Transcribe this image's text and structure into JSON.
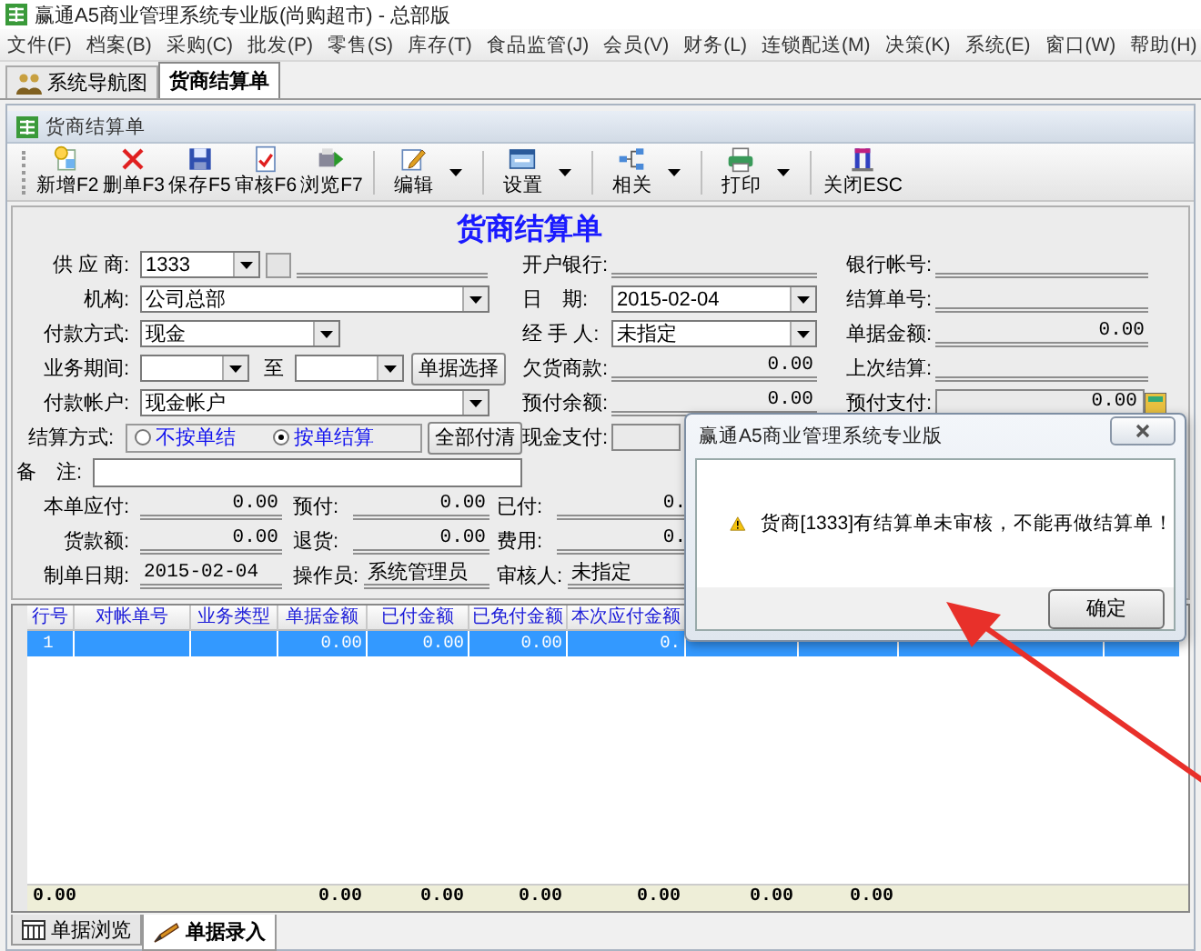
{
  "window": {
    "title": "赢通A5商业管理系统专业版(尚购超市) - 总部版"
  },
  "menu": [
    "文件(F)",
    "档案(B)",
    "采购(C)",
    "批发(P)",
    "零售(S)",
    "库存(T)",
    "食品监管(J)",
    "会员(V)",
    "财务(L)",
    "连锁配送(M)",
    "决策(K)",
    "系统(E)",
    "窗口(W)",
    "帮助(H)"
  ],
  "tabs": [
    {
      "label": "系统导航图",
      "selected": false
    },
    {
      "label": "货商结算单",
      "selected": true
    }
  ],
  "panel": {
    "title": "货商结算单"
  },
  "toolbar": [
    {
      "label": "新增F2",
      "kind": "button"
    },
    {
      "label": "删单F3",
      "kind": "button"
    },
    {
      "label": "保存F5",
      "kind": "button"
    },
    {
      "label": "审核F6",
      "kind": "button"
    },
    {
      "label": "浏览F7",
      "kind": "button"
    },
    {
      "label": "编辑",
      "kind": "dropdown"
    },
    {
      "label": "设置",
      "kind": "dropdown"
    },
    {
      "label": "相关",
      "kind": "dropdown"
    },
    {
      "label": "打印",
      "kind": "dropdown"
    },
    {
      "label": "关闭ESC",
      "kind": "button"
    }
  ],
  "form": {
    "heading": "货商结算单",
    "rows": [
      {
        "kind": "main",
        "cells": [
          {
            "label": "供 应 商:",
            "kind": "lookup",
            "value": "1333"
          },
          {
            "label": "开户银行:",
            "kind": "line"
          },
          {
            "label": "银行帐号:",
            "kind": "line"
          }
        ]
      },
      {
        "kind": "main",
        "cells": [
          {
            "label": "机构:",
            "kind": "combo",
            "value": "公司总部"
          },
          {
            "label": "日　期:",
            "kind": "combo",
            "value": "2015-02-04"
          },
          {
            "label": "结算单号:",
            "kind": "line"
          }
        ]
      },
      {
        "kind": "main",
        "cells": [
          {
            "label": "付款方式:",
            "kind": "short-combo",
            "value": "现金"
          },
          {
            "label": "经 手 人:",
            "kind": "combo",
            "value": "未指定"
          },
          {
            "label": "单据金额:",
            "kind": "line",
            "value": "0.00"
          }
        ]
      },
      {
        "kind": "main",
        "cells": [
          {
            "label": "业务期间:",
            "kind": "period",
            "separator": "至",
            "button": "单据选择"
          },
          {
            "label": "欠货商款:",
            "kind": "line",
            "value": "0.00"
          },
          {
            "label": "上次结算:",
            "kind": "line"
          }
        ]
      },
      {
        "kind": "main",
        "cells": [
          {
            "label": "付款帐户:",
            "kind": "combo",
            "value": "现金帐户"
          },
          {
            "label": "预付余额:",
            "kind": "line",
            "value": "0.00"
          },
          {
            "label": "预付支付:",
            "kind": "box",
            "value": "0.00"
          }
        ]
      },
      {
        "kind": "main",
        "cells": [
          {
            "label": "结算方式:",
            "kind": "radios",
            "options": [
              {
                "label": "不按单结",
                "selected": false
              },
              {
                "label": "按单结算",
                "selected": true
              }
            ],
            "button": "全部付清"
          },
          {
            "label": "现金支付:",
            "kind": "box"
          }
        ]
      },
      {
        "kind": "main",
        "cells": [
          {
            "label": "备　注:",
            "kind": "input"
          }
        ]
      },
      {
        "kind": "compact",
        "cells": [
          {
            "label": "本单应付:",
            "kind": "line",
            "value": "0.00"
          },
          {
            "label": "预付:",
            "kind": "line",
            "value": "0.00"
          },
          {
            "label": "已付:",
            "kind": "line",
            "value": "0."
          }
        ]
      },
      {
        "kind": "compact",
        "cells": [
          {
            "label": "货款额:",
            "kind": "line",
            "value": "0.00"
          },
          {
            "label": "退货:",
            "kind": "line",
            "value": "0.00"
          },
          {
            "label": "费用:",
            "kind": "line",
            "value": "0."
          }
        ]
      },
      {
        "kind": "compact",
        "cells": [
          {
            "label": "制单日期:",
            "kind": "text",
            "value": "2015-02-04"
          },
          {
            "label": "操作员:",
            "kind": "text",
            "value": "系统管理员"
          },
          {
            "label": "审核人:",
            "kind": "text",
            "value": "未指定"
          }
        ]
      }
    ]
  },
  "grid": {
    "columns": [
      "行号",
      "对帐单号",
      "业务类型",
      "单据金额",
      "已付金额",
      "已免付金额",
      "本次应付金额"
    ],
    "rows": [
      {
        "selected": true,
        "number": "1",
        "amounts": [
          "0.00",
          "0.00",
          "0.00",
          "0."
        ]
      }
    ],
    "totals": {
      "first": "0.00",
      "amounts": [
        "0.00",
        "0.00",
        "0.00",
        "0.00",
        "0.00",
        "0.00"
      ]
    }
  },
  "bottom_tabs": [
    {
      "label": "单据浏览",
      "selected": false
    },
    {
      "label": "单据录入",
      "selected": true
    }
  ],
  "dialog": {
    "title": "赢通A5商业管理系统专业版",
    "message": "货商[1333]有结算单未审核，不能再做结算单！",
    "button": "确定"
  },
  "annotation": {
    "kind": "arrow"
  }
}
